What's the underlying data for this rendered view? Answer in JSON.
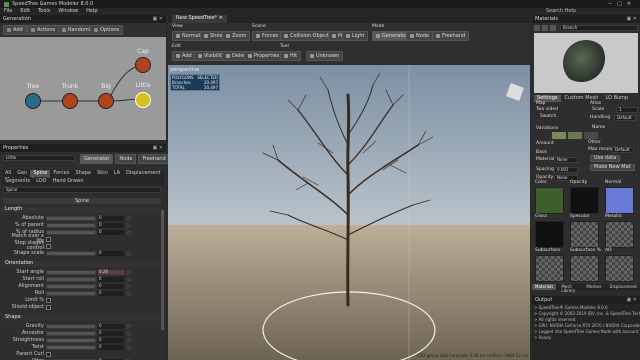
{
  "window": {
    "title": "SpeedTree Games Modeler 8.0.0",
    "controls": [
      "−",
      "□",
      "✕"
    ]
  },
  "menu": [
    "File",
    "Edit",
    "Tools",
    "Window",
    "Help"
  ],
  "search_help": "Search Help",
  "generation": {
    "title": "Generation",
    "toolbar": [
      "Add",
      "Actions",
      "Randomize",
      "Options"
    ],
    "nodes": [
      {
        "label": "Tree",
        "color": "#2a6a8a"
      },
      {
        "label": "Trunk",
        "color": "#b04420"
      },
      {
        "label": "Big",
        "color": "#b04420"
      },
      {
        "label": "Cap",
        "color": "#b04420"
      },
      {
        "label": "Little",
        "color": "#d8c020"
      }
    ]
  },
  "doc_tab": "New SpeedTree*",
  "toolbar": {
    "view_label": "View",
    "view": [
      "Normals",
      "Show",
      "Zoom"
    ],
    "scene_label": "Scene",
    "scene": [
      "Forces",
      "Collision Objects",
      "Props",
      "Light"
    ],
    "mode_label": "Mode",
    "mode": [
      "Generator",
      "Node",
      "Freehand"
    ],
    "edit_label": "Edit",
    "edit": [
      "Add",
      "Visibility",
      "Delete",
      "Properties"
    ],
    "tool_label": "Tool",
    "tool": [
      "Hit",
      "Unknown"
    ]
  },
  "viewport": {
    "label": "perspective",
    "stats": [
      {
        "k": "POLYGONS",
        "v": "SELECTED"
      },
      {
        "k": "Branches",
        "v": "20,497"
      },
      {
        "k": "TOTAL",
        "v": "20,497"
      }
    ],
    "status": "LOD group   LOD Complete 2.38 ms   Uniform 3986.52 ms"
  },
  "properties": {
    "title": "Properties",
    "generator_name": "Little",
    "mode": [
      "Generator",
      "Node",
      "Freehand"
    ],
    "tabs1": [
      "All",
      "Gen",
      "Spine",
      "Forces",
      "Shape",
      "Skin",
      "LA",
      "Displacement",
      "Material",
      "Animation"
    ],
    "tabs2": [
      "Segments",
      "LOD",
      "Hand Drawn"
    ],
    "selector": "Spine",
    "spine_header": "Spine",
    "sections": [
      {
        "name": "Length",
        "rows": [
          {
            "label": "Absolute",
            "value": "0"
          },
          {
            "label": "% of parent",
            "value": "0"
          },
          {
            "label": "% of radius",
            "value": "0"
          },
          {
            "label": "Match over x life",
            "value": ""
          },
          {
            "label": "Stop stages control",
            "value": ""
          },
          {
            "label": "Shape scale",
            "value": "0"
          }
        ]
      },
      {
        "name": "Orientation",
        "rows": [
          {
            "label": "Start angle",
            "value": "0.26"
          },
          {
            "label": "Start roll",
            "value": "0"
          },
          {
            "label": "Alignment",
            "value": "0"
          },
          {
            "label": "Roll",
            "value": "0"
          },
          {
            "label": "Limit %",
            "value": ""
          },
          {
            "label": "Shield object",
            "value": ""
          }
        ]
      },
      {
        "name": "Shape",
        "rows": [
          {
            "label": "Gravity",
            "value": "0"
          },
          {
            "label": "Ancestor",
            "value": "0"
          },
          {
            "label": "Straightness",
            "value": "0"
          },
          {
            "label": "Twist",
            "value": "0"
          },
          {
            "label": "Parent Curl",
            "value": ""
          },
          {
            "label": "Jitter",
            "value": "0"
          }
        ]
      }
    ]
  },
  "materials": {
    "title": "Materials",
    "search_value": "Branch",
    "tabs": [
      "Settings",
      "Custom Mesh",
      "LO Bump"
    ],
    "map_section": "Map",
    "atlas_section": "Atlas",
    "fields": [
      {
        "label": "Two sided",
        "value": ""
      },
      {
        "label": "Scale",
        "value": "1"
      },
      {
        "label": "Swatch",
        "value": ""
      },
      {
        "label": "Handling",
        "value": "Default"
      },
      {
        "label": "Name",
        "value": ""
      },
      {
        "label": "Variations",
        "value": ""
      },
      {
        "label": "Amount",
        "value": ""
      },
      {
        "label": "Max resolution",
        "value": "Default"
      },
      {
        "label": "Back",
        "value": ""
      },
      {
        "label": "Material",
        "value": "None"
      },
      {
        "label": "Spacing",
        "value": "0.001"
      },
      {
        "label": "Other",
        "value": ""
      },
      {
        "label": "Opacity",
        "value": "None"
      }
    ],
    "use_data": "Use data",
    "make_new": "Make New Mat",
    "maps": [
      "Color",
      "Opacity",
      "Normal",
      "Gloss",
      "Specular",
      "Metallic",
      "Subsurface",
      "Subsurface %",
      "AO"
    ],
    "bottom_tabs": [
      "Materials",
      "Mesh Library",
      "Meshes",
      "Displacement"
    ]
  },
  "output": {
    "title": "Output",
    "lines": [
      "> SpeedTree® Games Modeler 8.0.0",
      "> Copyright © 2002-2019 IDV, Inc. & SpeedTree Technologies",
      "> All rights reserved.",
      "> GPU: NVIDIA GeForce RTX 2070 / NVIDIA Corporation",
      "> Logged into SpeedTree Games Node with account TeethandNew",
      "> Ready."
    ]
  }
}
